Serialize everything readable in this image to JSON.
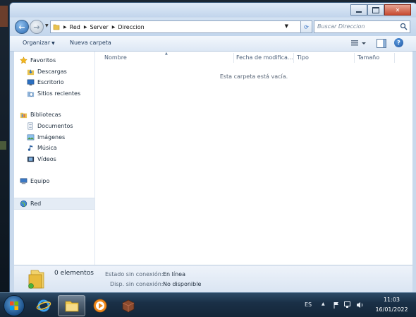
{
  "window": {
    "breadcrumb": [
      "Red",
      "Server",
      "Direccion"
    ],
    "search_placeholder": "Buscar Direccion"
  },
  "toolbar": {
    "organize_label": "Organizar",
    "new_folder_label": "Nueva carpeta"
  },
  "nav_pane": {
    "favorites_label": "Favoritos",
    "favorites": [
      "Descargas",
      "Escritorio",
      "Sitios recientes"
    ],
    "libraries_label": "Bibliotecas",
    "libraries": [
      "Documentos",
      "Imágenes",
      "Música",
      "Vídeos"
    ],
    "computer_label": "Equipo",
    "network_label": "Red"
  },
  "columns": [
    "Nombre",
    "Fecha de modifica...",
    "Tipo",
    "Tamaño"
  ],
  "empty_message": "Esta carpeta está vacía.",
  "details": {
    "count": "0 elementos",
    "offline_status_label": "Estado sin conexión:",
    "offline_status_value": "En línea",
    "offline_avail_label": "Disp. sin conexión:",
    "offline_avail_value": "No disponible"
  },
  "taskbar": {
    "language": "ES",
    "time": "11:03",
    "date": "16/01/2022"
  },
  "icons": {
    "back": "back-arrow-icon",
    "forward": "forward-arrow-icon",
    "refresh": "refresh-icon",
    "search": "search-icon",
    "help": "help-icon"
  },
  "colors": {
    "window_frame": "#c9d9ec",
    "close_button": "#c74b32",
    "taskbar": "#1a3047"
  }
}
